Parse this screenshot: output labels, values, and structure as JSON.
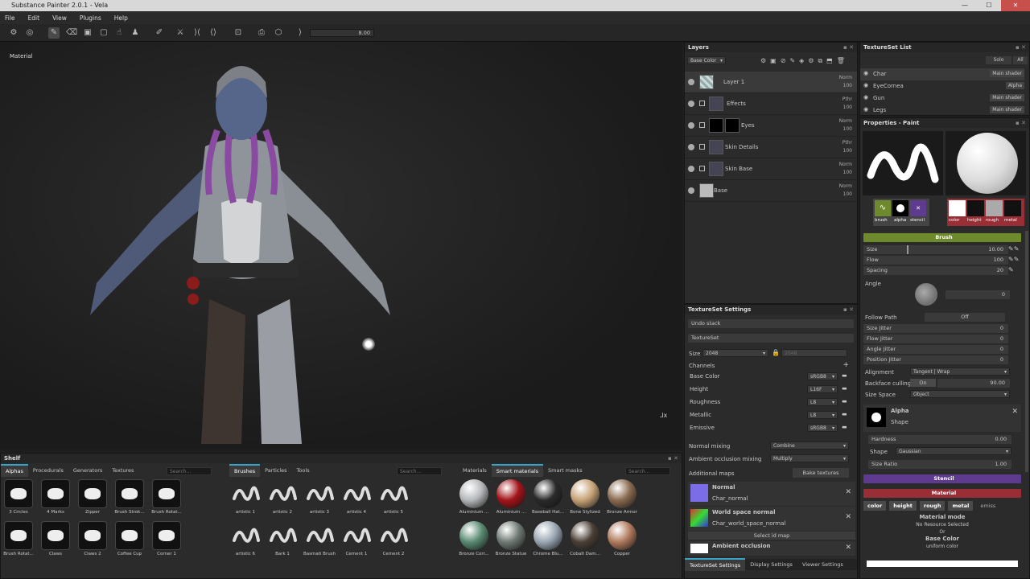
{
  "app": {
    "title": "Substance Painter 2.0.1 - Vela"
  },
  "menu": [
    "File",
    "Edit",
    "View",
    "Plugins",
    "Help"
  ],
  "toolbar": {
    "value": "8.00"
  },
  "viewport": {
    "label": "Material"
  },
  "layers": {
    "title": "Layers",
    "channel": "Base Color",
    "items": [
      {
        "name": "Layer 1",
        "mode": "Norm",
        "opacity": "100"
      },
      {
        "name": "Effects",
        "mode": "Pthr",
        "opacity": "100"
      },
      {
        "name": "Eyes",
        "mode": "Norm",
        "opacity": "100"
      },
      {
        "name": "Skin Details",
        "mode": "Pthr",
        "opacity": "100"
      },
      {
        "name": "Skin Base",
        "mode": "Norm",
        "opacity": "100"
      },
      {
        "name": "Base",
        "mode": "Norm",
        "opacity": "100"
      }
    ]
  },
  "textureset_list": {
    "title": "TextureSet List",
    "solo": "Solo",
    "all": "All",
    "items": [
      {
        "name": "Char",
        "shader": "Main shader"
      },
      {
        "name": "EyeCornea",
        "shader": "Alpha"
      },
      {
        "name": "Gun",
        "shader": "Main shader"
      },
      {
        "name": "Legs",
        "shader": "Main shader"
      }
    ]
  },
  "properties": {
    "title": "Properties - Paint",
    "tools": [
      "brush",
      "alpha",
      "stencil"
    ],
    "materials": [
      "color",
      "height",
      "rough",
      "metal"
    ],
    "brush_title": "Brush",
    "size_label": "Size",
    "size_value": "10.00",
    "flow_label": "Flow",
    "flow_value": "100",
    "spacing_label": "Spacing",
    "spacing_value": "20",
    "angle_label": "Angle",
    "angle_value": "0",
    "follow_path_label": "Follow Path",
    "follow_path_value": "Off",
    "jitters": [
      {
        "label": "Size Jitter",
        "value": "0"
      },
      {
        "label": "Flow Jitter",
        "value": "0"
      },
      {
        "label": "Angle Jitter",
        "value": "0"
      },
      {
        "label": "Position Jitter",
        "value": "0"
      }
    ],
    "alignment_label": "Alignment",
    "alignment_value": "Tangent | Wrap",
    "backface_label": "Backface culling",
    "backface_on": "On",
    "backface_value": "90.00",
    "sizespace_label": "Size Space",
    "sizespace_value": "Object",
    "alpha_title": "Alpha",
    "alpha_sub": "Shape",
    "hardness_label": "Hardness",
    "hardness_value": "0.00",
    "shape_label": "Shape",
    "shape_value": "Gaussian",
    "sizeratio_label": "Size Ratio",
    "sizeratio_value": "1.00",
    "stencil_title": "Stencil",
    "material_title": "Material",
    "mat_tabs": [
      "color",
      "height",
      "rough",
      "metal",
      "emiss"
    ],
    "material_mode": "Material mode",
    "no_resource": "No Resource Selected",
    "or": "Or",
    "base_color": "Base Color",
    "uniform": "uniform color"
  },
  "textureset_settings": {
    "title": "TextureSet Settings",
    "undo": "Undo stack",
    "textureset": "TextureSet",
    "size_label": "Size",
    "size_value": "2048",
    "size_value2": "2048",
    "channels_label": "Channels",
    "channels": [
      {
        "name": "Base Color",
        "format": "sRGB8"
      },
      {
        "name": "Height",
        "format": "L16F"
      },
      {
        "name": "Roughness",
        "format": "L8"
      },
      {
        "name": "Metallic",
        "format": "L8"
      },
      {
        "name": "Emissive",
        "format": "sRGB8"
      }
    ],
    "normal_mixing_label": "Normal mixing",
    "normal_mixing_value": "Combine",
    "ao_mixing_label": "Ambient occlusion mixing",
    "ao_mixing_value": "Multiply",
    "additional_maps": "Additional maps",
    "bake": "Bake textures",
    "maps": [
      {
        "name": "Normal",
        "file": "Char_normal"
      },
      {
        "name": "World space normal",
        "file": "Char_world_space_normal"
      }
    ],
    "select_id": "Select id map",
    "ambient": "Ambient occlusion",
    "bottom_tabs": [
      "TextureSet Settings",
      "Display Settings",
      "Viewer Settings"
    ]
  },
  "shelf": {
    "title": "Shelf",
    "tabs1": [
      "Alphas",
      "Procedurals",
      "Generators",
      "Textures"
    ],
    "tabs2": [
      "Brushes",
      "Particles",
      "Tools"
    ],
    "tabs3": [
      "Materials",
      "Smart materials",
      "Smart masks"
    ],
    "search": "Search...",
    "alphas": [
      "3 Circles",
      "4 Marks",
      "Zipper",
      "Brush Strok...",
      "Brush Rotat...",
      "Brush Rotat...",
      "Claws",
      "Claws 2",
      "Coffee Cup",
      "Corner 1"
    ],
    "brushes": [
      "artistic 1",
      "artistic 2",
      "artistic 3",
      "artistic 4",
      "artistic 5",
      "artistic 6",
      "Bark 1",
      "Basmati Brush",
      "Cement 1",
      "Cement 2"
    ],
    "materials": [
      "Aluminium ...",
      "Aluminium ...",
      "Baseball Hat...",
      "Bone Stylized",
      "Bronze Armor",
      "Bronze Corr...",
      "Bronze Statue",
      "Chrome Blu...",
      "Cobalt Dam...",
      "Copper"
    ]
  },
  "colors": {
    "accent": "#3aa3c9",
    "brush": "#6f8a2c",
    "stencil": "#5e3b8e",
    "material": "#9a2e37"
  }
}
